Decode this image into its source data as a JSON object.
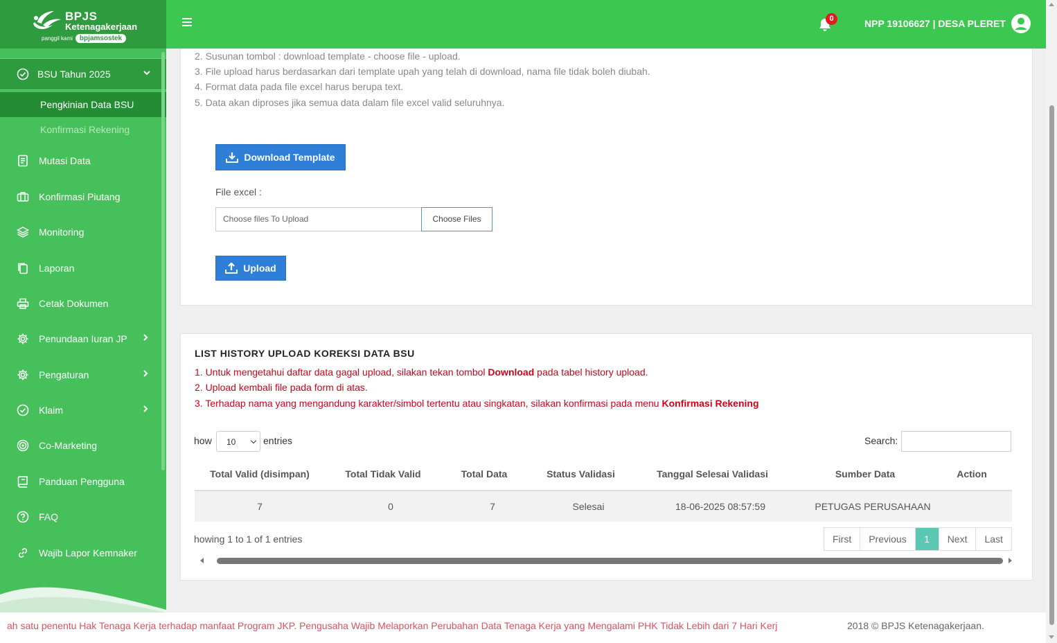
{
  "brand": {
    "name": "BPJS",
    "subname": "Ketenagakerjaan",
    "tagline_prefix": "panggil kami",
    "tagline_pill": "bpjamsostek"
  },
  "header": {
    "notification_count": "0",
    "user_label": "NPP 19106627 | DESA PLERET"
  },
  "sidebar": {
    "active_parent": "BSU Tahun 2025",
    "sub_items": [
      "Pengkinian Data BSU",
      "Konfirmasi Rekening"
    ],
    "items": [
      {
        "label": "Mutasi Data",
        "icon": "document-icon"
      },
      {
        "label": "Konfirmasi Piutang",
        "icon": "briefcase-icon"
      },
      {
        "label": "Monitoring",
        "icon": "layers-icon"
      },
      {
        "label": "Laporan",
        "icon": "copy-icon"
      },
      {
        "label": "Cetak Dokumen",
        "icon": "printer-icon"
      },
      {
        "label": "Penundaan Iuran JP",
        "icon": "gear-icon"
      },
      {
        "label": "Pengaturan",
        "icon": "gear-icon"
      },
      {
        "label": "Klaim",
        "icon": "check-circle-icon"
      },
      {
        "label": "Co-Marketing",
        "icon": "target-icon"
      },
      {
        "label": "Panduan Pengguna",
        "icon": "book-icon"
      },
      {
        "label": "FAQ",
        "icon": "question-icon"
      },
      {
        "label": "Wajib Lapor Kemnaker",
        "icon": "link-icon"
      }
    ]
  },
  "upload_card": {
    "instructions": [
      "2. Susunan tombol : download template - choose file - upload.",
      "3. File upload harus berdasarkan dari template upah yang telah di download, nama file tidak boleh diubah.",
      "4. Format data pada file excel harus berupa text.",
      "5. Data akan diproses jika semua data dalam file excel valid seluruhnya."
    ],
    "download_button": "Download Template",
    "file_label": "File excel :",
    "file_placeholder": "Choose files To Upload",
    "choose_button": "Choose Files",
    "upload_button": "Upload"
  },
  "history_card": {
    "title": "LIST HISTORY UPLOAD KOREKSI DATA BSU",
    "note1_pre": "1. Untuk mengetahui daftar data gagal upload, silakan tekan tombol ",
    "note1_bold": "Download",
    "note1_post": " pada tabel history upload.",
    "note2": "2. Upload kembali file pada form di atas.",
    "note3_pre": "3. Terhadap nama yang mengandung karakter/simbol tertentu atau singkatan, silakan konfirmasi pada menu ",
    "note3_bold": "Konfirmasi Rekening",
    "length_prefix": "how",
    "length_value": "10",
    "length_suffix": "entries",
    "search_label": "Search:",
    "columns": [
      "Total Valid (disimpan)",
      "Total Tidak Valid",
      "Total Data",
      "Status Validasi",
      "Tanggal Selesai Validasi",
      "Sumber Data",
      "Action"
    ],
    "rows": [
      [
        "7",
        "0",
        "7",
        "Selesai",
        "18-06-2025 08:57:59",
        "PETUGAS PERUSAHAAN",
        ""
      ]
    ],
    "info": "howing 1 to 1 of 1 entries",
    "pager": [
      "First",
      "Previous",
      "1",
      "Next",
      "Last"
    ]
  },
  "footer": {
    "marquee": "ah satu penentu Hak Tenaga Kerja terhadap manfaat Program JKP. Pengusaha Wajib Melaporkan Perubahan Data Tenaga Kerja yang Mengalami PHK Tidak Lebih dari 7 Hari Kerja",
    "copyright": "2018 © BPJS Ketenagakerjaan."
  }
}
